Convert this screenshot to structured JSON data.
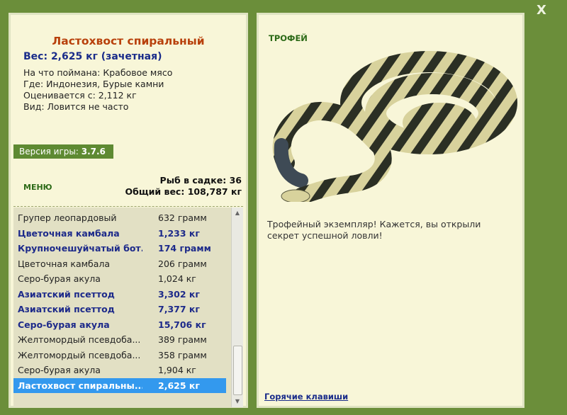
{
  "close_label": "X",
  "fish": {
    "title": "Ластохвост спиральный",
    "weight_line": "Вес: 2,625 кг (зачетная)",
    "bait": "На что поймана: Крабовое мясо",
    "where": "Где: Индонезия, Бурые камни",
    "estimated": "Оценивается с: 2,112 кг",
    "kind": "Вид: Ловится не часто"
  },
  "version": {
    "label": "Версия игры:",
    "value": "3.7.6"
  },
  "menu_label": "МЕНЮ",
  "stats": {
    "in_net": "Рыб в садке: 36",
    "total_weight": "Общий вес: 108,787 кг"
  },
  "list": [
    {
      "name": "Групер леопардовый",
      "weight": "632 грамм",
      "style": "normal"
    },
    {
      "name": "Цветочная камбала",
      "weight": "1,233 кг",
      "style": "hl"
    },
    {
      "name": "Крупночешуйчатый бот...",
      "weight": "174 грамм",
      "style": "hl"
    },
    {
      "name": "Цветочная камбала",
      "weight": "206 грамм",
      "style": "normal"
    },
    {
      "name": "Серо-бурая акула",
      "weight": "1,024 кг",
      "style": "normal"
    },
    {
      "name": "Азиатский псеттод",
      "weight": "3,302 кг",
      "style": "hl"
    },
    {
      "name": "Азиатский псеттод",
      "weight": "7,377 кг",
      "style": "hl"
    },
    {
      "name": "Серо-бурая акула",
      "weight": "15,706 кг",
      "style": "hl"
    },
    {
      "name": "Желтомордый псевдоба...",
      "weight": "389 грамм",
      "style": "normal"
    },
    {
      "name": "Желтомордый псевдоба...",
      "weight": "358 грамм",
      "style": "normal"
    },
    {
      "name": "Серо-бурая акула",
      "weight": "1,904 кг",
      "style": "normal"
    },
    {
      "name": "Ластохвост спиральны...",
      "weight": "2,625 кг",
      "style": "sel"
    }
  ],
  "trophy": {
    "label": "ТРОФЕЙ",
    "text": "Трофейный экземпляр! Кажется, вы открыли секрет успешной ловли!"
  },
  "hotkeys_label": "Горячие клавиши",
  "colors": {
    "frame": "#6b8e3a",
    "panel": "#f8f6d8",
    "title": "#b8400b",
    "highlight": "#1a2c8a",
    "selected": "#3399ee",
    "green_text": "#2c6a17"
  }
}
